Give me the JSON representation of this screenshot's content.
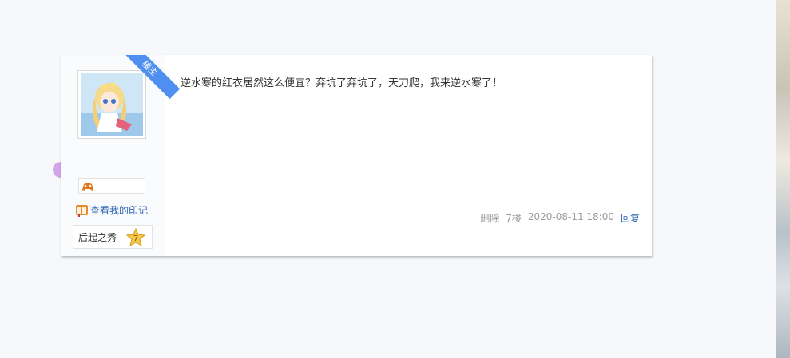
{
  "post": {
    "ribbon_label": "楼主",
    "content": "逆水寒的红衣居然这么便宜？弃坑了弃坑了，天刀爬，我来逆水寒了！",
    "footer": {
      "delete_label": "删除",
      "floor": "7楼",
      "timestamp": "2020-08-11 18:00",
      "reply_label": "回复"
    }
  },
  "user": {
    "avatar_icon": "anime-avatar-icon",
    "level_icon": "game-controller-icon",
    "imprint_label": "查看我的印记",
    "imprint_icon": "book-icon",
    "badge_title": "后起之秀",
    "badge_level": "7"
  },
  "colors": {
    "accent": "#4f8ff0",
    "link": "#2d64b3",
    "background": "#f7f8fc"
  }
}
